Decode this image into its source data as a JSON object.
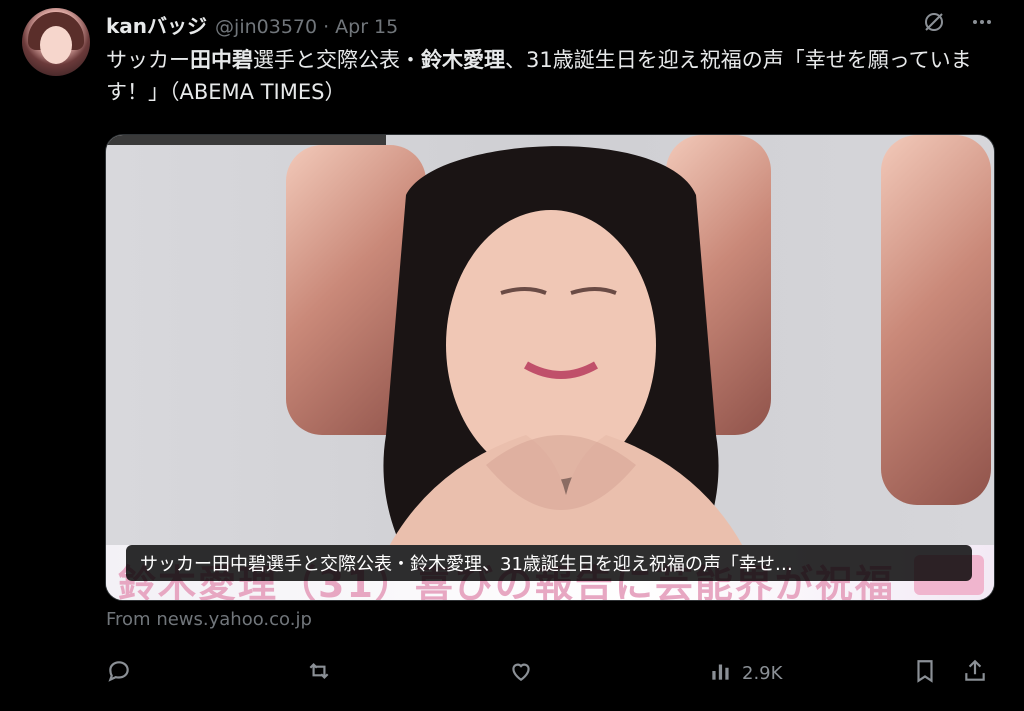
{
  "author": {
    "display_name": "kanバッジ",
    "handle": "@jin03570",
    "separator": "·",
    "date": "Apr 15"
  },
  "tweet": {
    "text_part1": "サッカー",
    "text_bold1": "田中碧",
    "text_part2": "選手と交際公表・",
    "text_bold2": "鈴木愛理",
    "text_part3": "、31歳誕生日を迎え祝福の声「幸せを願っています！」（ABEMA TIMES）"
  },
  "card": {
    "caption": "サッカー田中碧選手と交際公表・鈴木愛理、31歳誕生日を迎え祝福の声「幸せ…",
    "image_overlay_text": "鈴木愛理（31）喜びの報告に芸能界が祝福"
  },
  "source": {
    "label": "From news.yahoo.co.jp"
  },
  "actions": {
    "reply_icon": "reply-icon",
    "retweet_icon": "retweet-icon",
    "like_icon": "heart-icon",
    "views_icon": "views-icon",
    "views_count": "2.9K",
    "bookmark_icon": "bookmark-icon",
    "share_icon": "share-icon"
  },
  "top_icons": {
    "grok_icon": "no-slash-circle-icon",
    "more_icon": "more-icon"
  },
  "colors": {
    "background": "#000000",
    "text": "#e7e9ea",
    "muted": "#71767b"
  }
}
